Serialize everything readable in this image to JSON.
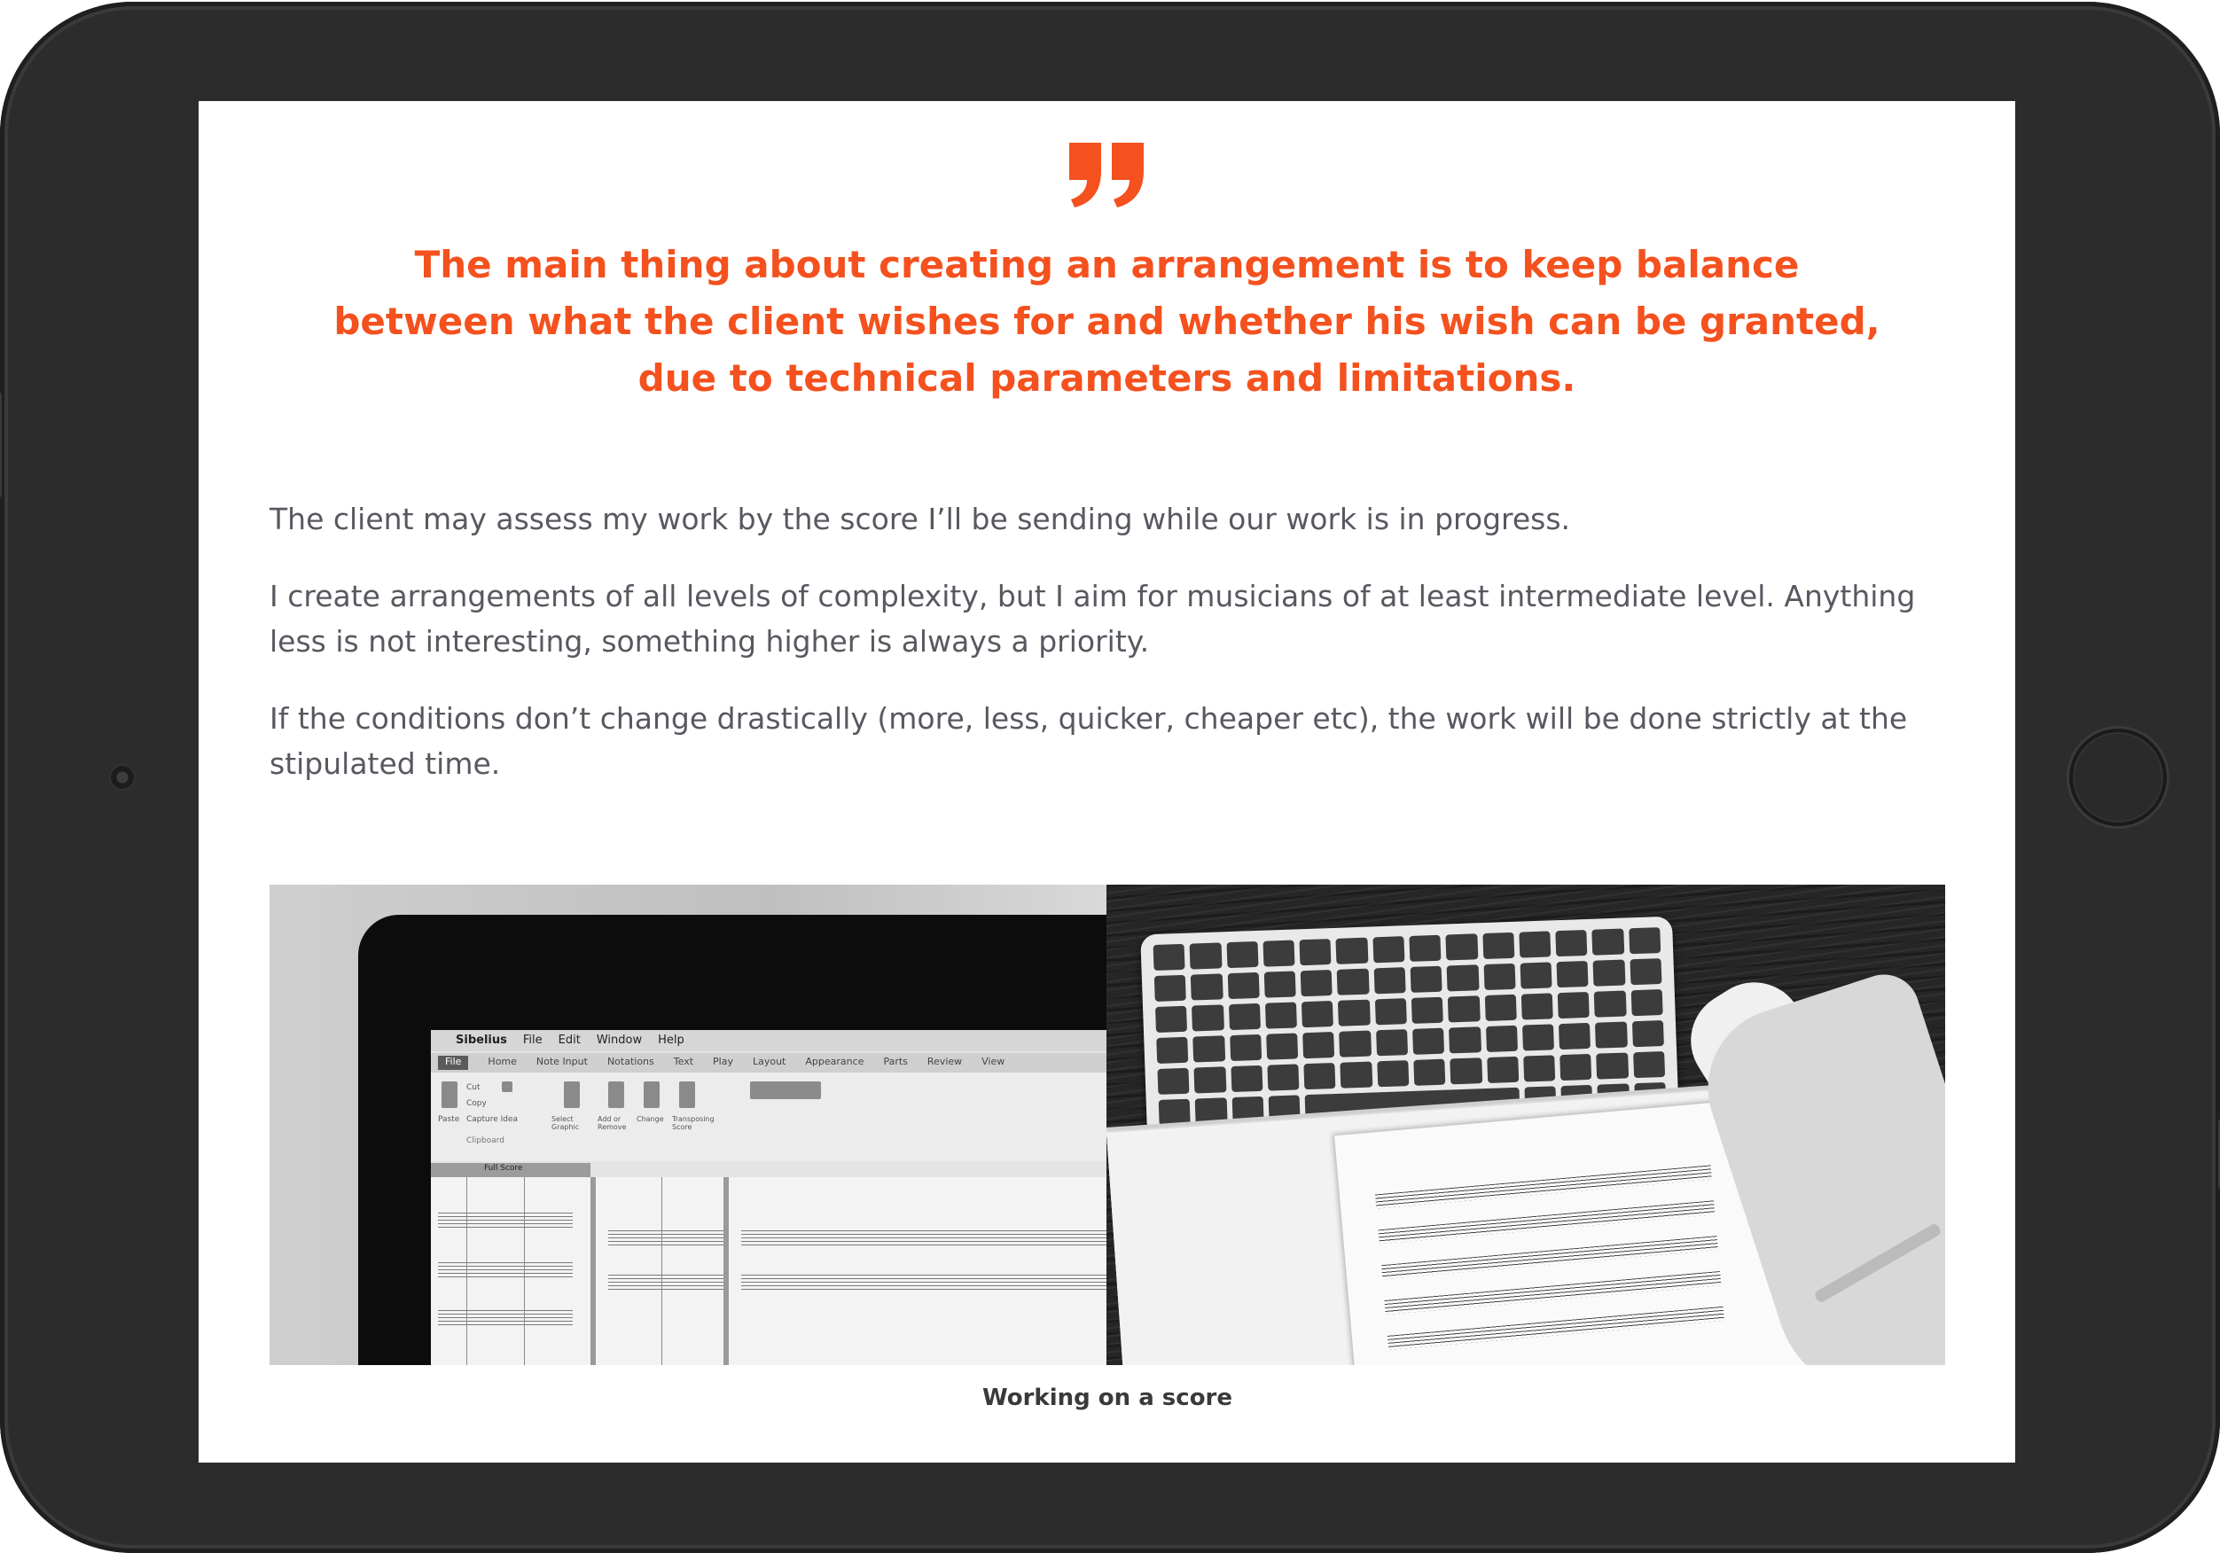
{
  "colors": {
    "accent": "#f4511e",
    "body_text": "#585860",
    "caption_text": "#3a3a3a",
    "device_frame": "#2c2c2c",
    "screen_bg": "#ffffff"
  },
  "quote": {
    "icon": "quote-icon",
    "lines": [
      "The main thing about creating an arrangement is to keep balance",
      "between what the client wishes for and whether his wish can be granted,",
      "due to technical parameters and limitations."
    ]
  },
  "paragraphs": [
    "The client may assess my work by the score I’ll be sending while our work is in progress.",
    "I create arrangements of all levels of complexity, but I aim for musicians of at least intermediate level. Anything less is not interesting, something higher is always a priority.",
    "If the conditions don’t change drastically (more, less, quicker, cheaper etc), the work will be done strictly at the stipulated time."
  ],
  "figure": {
    "left_photo": {
      "menubar": [
        "Sibelius",
        "File",
        "Edit",
        "Window",
        "Help"
      ],
      "tabs": [
        "File",
        "Home",
        "Note Input",
        "Notations",
        "Text",
        "Play",
        "Layout",
        "Appearance",
        "Parts",
        "Review",
        "View"
      ],
      "ribbon_labels": [
        "Paste",
        "Cut",
        "Copy",
        "Capture Idea",
        "Clipboard",
        "Select Graphic",
        "Add or Remove",
        "Change",
        "Transposing Score"
      ],
      "status": "Full Score"
    },
    "caption": "Working on a score"
  }
}
